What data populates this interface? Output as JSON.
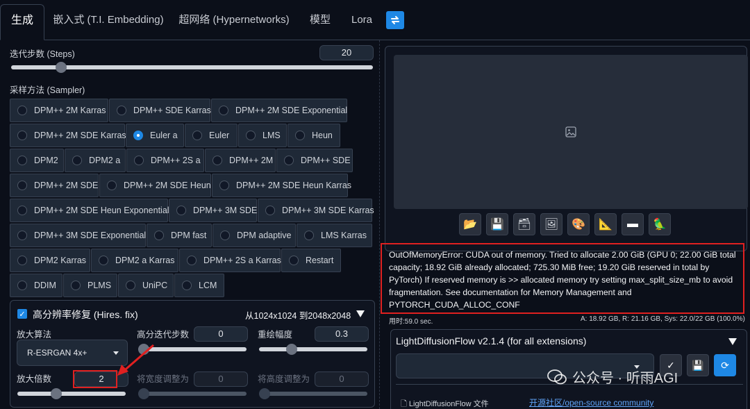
{
  "tabs": [
    {
      "label": "生成"
    },
    {
      "label": "嵌入式 (T.I. Embedding)"
    },
    {
      "label": "超网络 (Hypernetworks)"
    },
    {
      "label": "模型"
    },
    {
      "label": "Lora"
    }
  ],
  "steps": {
    "label": "迭代步数 (Steps)",
    "value": "20",
    "fraction": 0.13
  },
  "sampler": {
    "label": "采样方法 (Sampler)",
    "selected": "Euler a",
    "options": [
      "DPM++ 2M Karras",
      "DPM++ SDE Karras",
      "DPM++ 2M SDE Exponential",
      "DPM++ 2M SDE Karras",
      "Euler a",
      "Euler",
      "LMS",
      "Heun",
      "DPM2",
      "DPM2 a",
      "DPM++ 2S a",
      "DPM++ 2M",
      "DPM++ SDE",
      "DPM++ 2M SDE",
      "DPM++ 2M SDE Heun",
      "DPM++ 2M SDE Heun Karras",
      "DPM++ 2M SDE Heun Exponential",
      "DPM++ 3M SDE",
      "DPM++ 3M SDE Karras",
      "DPM++ 3M SDE Exponential",
      "DPM fast",
      "DPM adaptive",
      "LMS Karras",
      "DPM2 Karras",
      "DPM2 a Karras",
      "DPM++ 2S a Karras",
      "Restart",
      "DDIM",
      "PLMS",
      "UniPC",
      "LCM"
    ]
  },
  "hires": {
    "title": "高分辨率修复 (Hires. fix)",
    "resolution": "从1024x1024 到2048x2048",
    "upscaler_label": "放大算法",
    "upscaler_value": "R-ESRGAN 4x+",
    "hires_steps_label": "高分迭代步数",
    "hires_steps_value": "0",
    "denoise_label": "重绘幅度",
    "denoise_value": "0.3",
    "scale_label": "放大倍数",
    "scale_value": "2",
    "width_label": "将宽度调整为",
    "width_value": "0",
    "height_label": "将高度调整为",
    "height_value": "0"
  },
  "error_text": "OutOfMemoryError: CUDA out of memory. Tried to allocate 2.00 GiB (GPU 0; 22.00 GiB total capacity; 18.92 GiB already allocated; 725.30 MiB free; 19.20 GiB reserved in total by PyTorch) If reserved memory is >> allocated memory try setting max_split_size_mb to avoid fragmentation. See documentation for Memory Management and PYTORCH_CUDA_ALLOC_CONF",
  "stats": {
    "time": "用时:59.0 sec.",
    "memory": "A: 18.92 GB, R: 21.16 GB, Sys: 22.0/22 GB (100.0%)"
  },
  "ldf": {
    "title": "LightDiffusionFlow v2.1.4 (for all extensions)",
    "file_label": "LightDiffusionFlow 文件",
    "community_link": "开源社区/open-source community"
  },
  "watermark": "公众号 · 听雨AGI",
  "colors": {
    "accent": "#1e88e5",
    "error_border": "#e02020",
    "background": "#0b0f19"
  }
}
